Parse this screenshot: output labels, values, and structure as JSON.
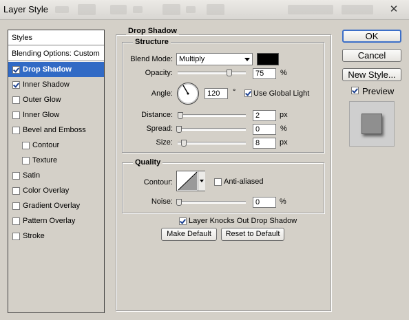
{
  "window": {
    "title": "Layer Style",
    "close_glyph": "✕"
  },
  "styles": {
    "header": "Styles",
    "blending_options": "Blending Options: Custom",
    "items": [
      {
        "label": "Drop Shadow",
        "checked": true,
        "selected": true
      },
      {
        "label": "Inner Shadow",
        "checked": true,
        "selected": false
      },
      {
        "label": "Outer Glow",
        "checked": false,
        "selected": false
      },
      {
        "label": "Inner Glow",
        "checked": false,
        "selected": false
      },
      {
        "label": "Bevel and Emboss",
        "checked": false,
        "selected": false
      },
      {
        "label": "Contour",
        "checked": false,
        "selected": false,
        "indent": true
      },
      {
        "label": "Texture",
        "checked": false,
        "selected": false,
        "indent": true
      },
      {
        "label": "Satin",
        "checked": false,
        "selected": false
      },
      {
        "label": "Color Overlay",
        "checked": false,
        "selected": false
      },
      {
        "label": "Gradient Overlay",
        "checked": false,
        "selected": false
      },
      {
        "label": "Pattern Overlay",
        "checked": false,
        "selected": false
      },
      {
        "label": "Stroke",
        "checked": false,
        "selected": false
      }
    ]
  },
  "drop_shadow": {
    "title": "Drop Shadow",
    "structure": {
      "title": "Structure",
      "blend_mode_label": "Blend Mode:",
      "blend_mode_value": "Multiply",
      "shadow_color": "#000000",
      "opacity_label": "Opacity:",
      "opacity_value": "75",
      "opacity_unit": "%",
      "opacity_fraction": 0.75,
      "angle_label": "Angle:",
      "angle_value": "120",
      "angle_unit": "°",
      "use_global_light_label": "Use Global Light",
      "use_global_light": true,
      "distance_label": "Distance:",
      "distance_value": "2",
      "distance_unit": "px",
      "spread_label": "Spread:",
      "spread_value": "0",
      "spread_unit": "%",
      "size_label": "Size:",
      "size_value": "8",
      "size_unit": "px"
    },
    "quality": {
      "title": "Quality",
      "contour_label": "Contour:",
      "anti_aliased_label": "Anti-aliased",
      "anti_aliased": false,
      "noise_label": "Noise:",
      "noise_value": "0",
      "noise_unit": "%"
    },
    "knockout_label": "Layer Knocks Out Drop Shadow",
    "knockout": true,
    "make_default_label": "Make Default",
    "reset_default_label": "Reset to Default"
  },
  "side": {
    "ok_label": "OK",
    "cancel_label": "Cancel",
    "new_style_label": "New Style...",
    "preview_label": "Preview",
    "preview_checked": true
  },
  "colors": {
    "selection": "#316ac5",
    "dialog_bg": "#d4d0c8"
  }
}
